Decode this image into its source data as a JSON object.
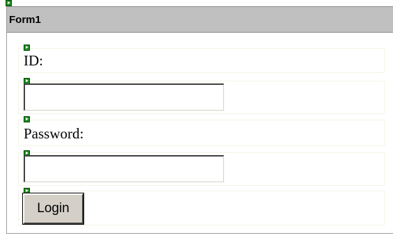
{
  "form": {
    "title": "Form1"
  },
  "fields": {
    "id": {
      "label": "ID:",
      "value": ""
    },
    "password": {
      "label": "Password:",
      "value": ""
    }
  },
  "actions": {
    "login_label": "Login"
  },
  "icons": {
    "marker": "green-arrow-marker-icon"
  },
  "colors": {
    "titlebar": "#c0c0c0",
    "marker": "#1d8a1d",
    "button_face": "#d4d0c8"
  }
}
